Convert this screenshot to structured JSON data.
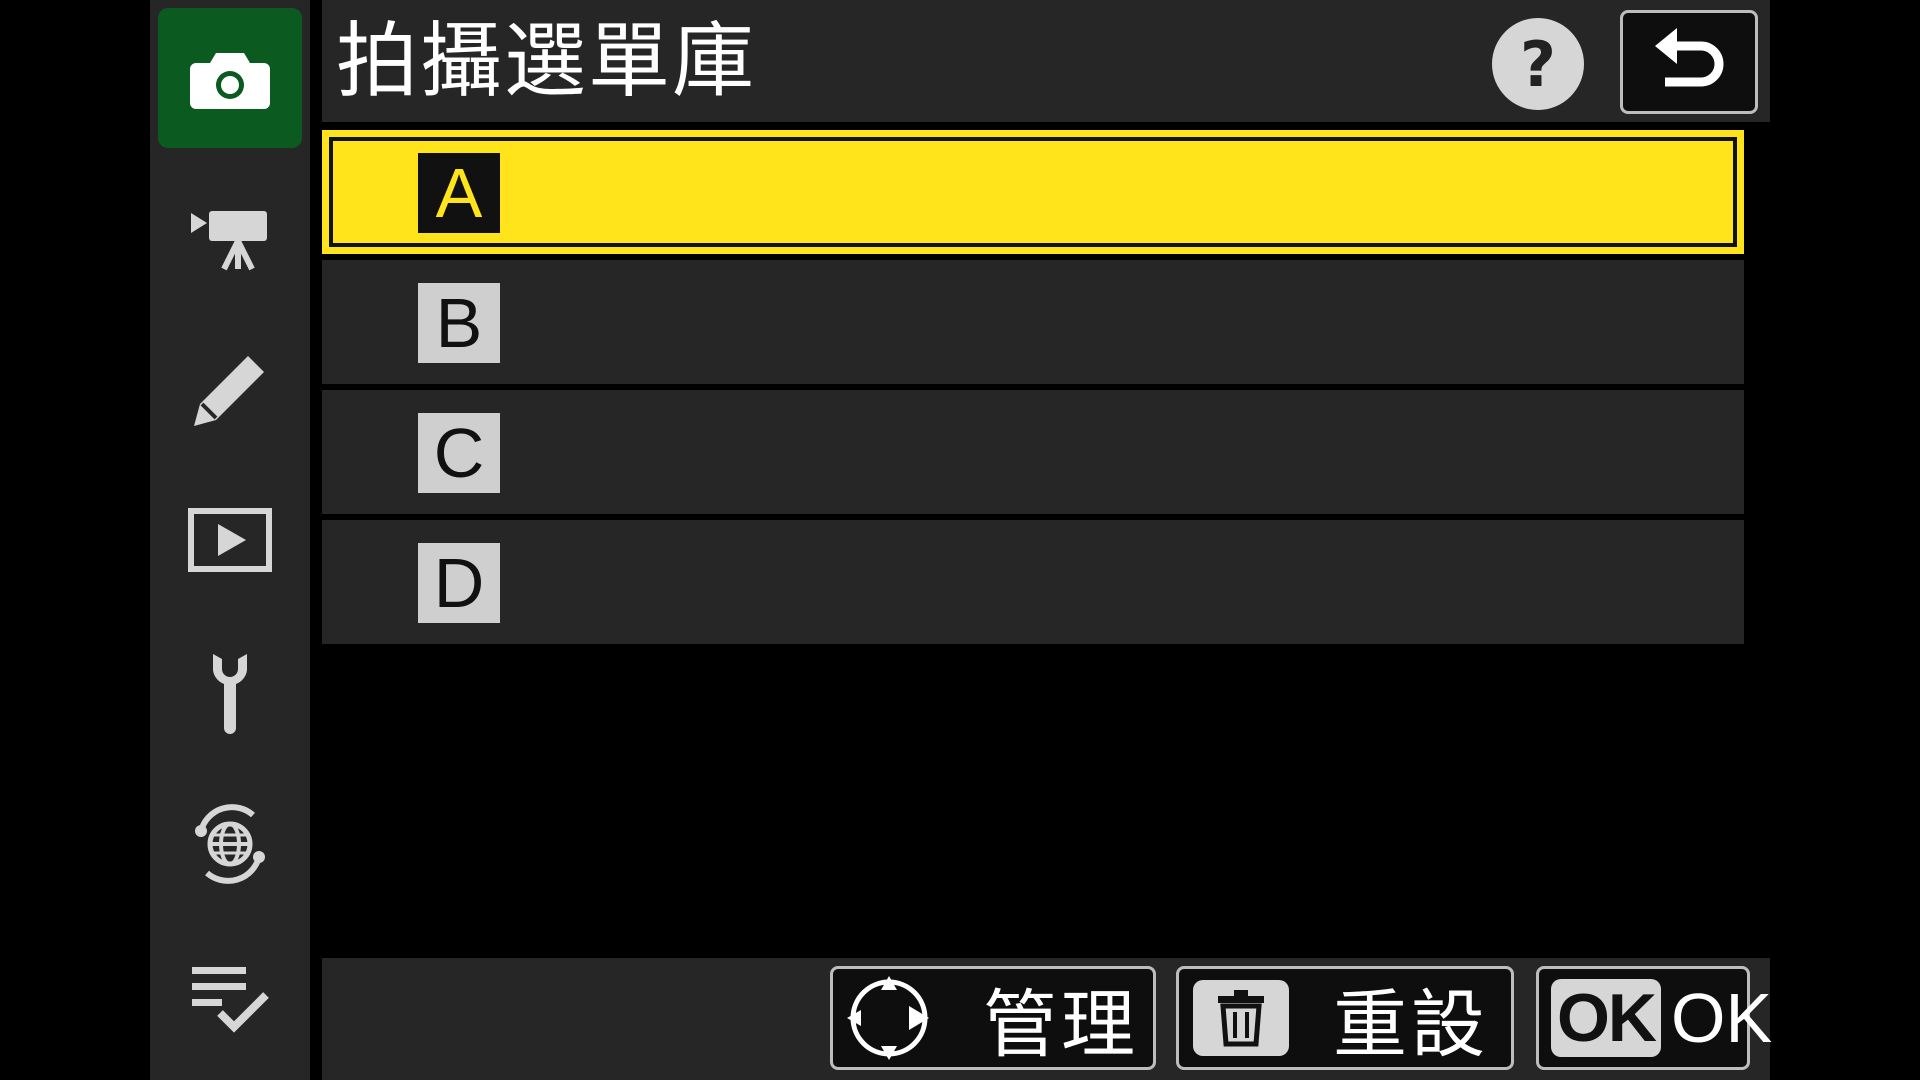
{
  "header": {
    "title": "拍攝選單庫",
    "help_label": "?"
  },
  "sidebar": {
    "tabs": [
      {
        "icon": "camera-icon",
        "active": true
      },
      {
        "icon": "movie-camera-icon",
        "active": false
      },
      {
        "icon": "pencil-icon",
        "active": false
      },
      {
        "icon": "playback-icon",
        "active": false
      },
      {
        "icon": "wrench-icon",
        "active": false
      },
      {
        "icon": "network-globe-icon",
        "active": false
      },
      {
        "icon": "my-menu-icon",
        "active": false
      }
    ]
  },
  "banks": [
    {
      "label": "A",
      "selected": true
    },
    {
      "label": "B",
      "selected": false
    },
    {
      "label": "C",
      "selected": false
    },
    {
      "label": "D",
      "selected": false
    }
  ],
  "footer": {
    "manage_label": "管理",
    "reset_label": "重設",
    "ok_key": "OK",
    "ok_label": "OK"
  },
  "colors": {
    "selection": "#ffe41c",
    "active_tab": "#0b5a1f",
    "panel": "#262626",
    "background": "#000000"
  }
}
